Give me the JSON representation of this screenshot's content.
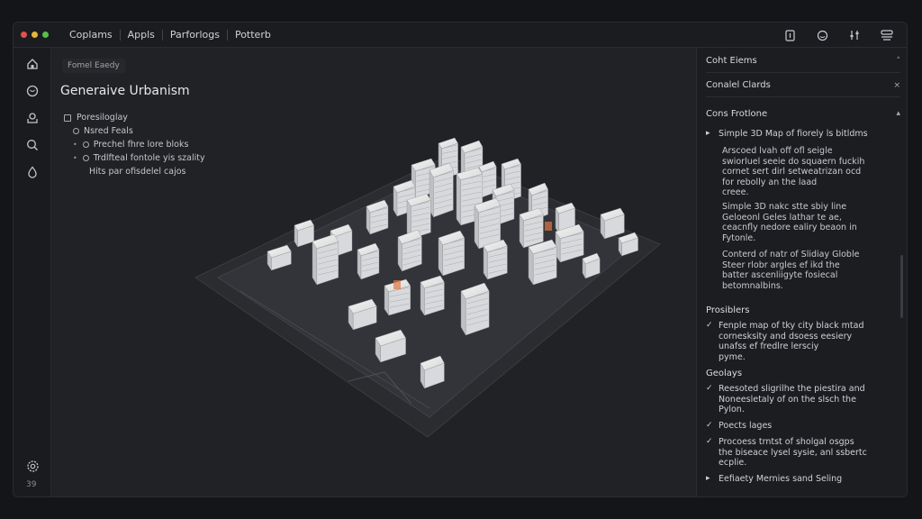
{
  "titlebar": {
    "menu": [
      "Coplams",
      "Appls",
      "Parforlogs",
      "Potterb"
    ],
    "icons": [
      "document-icon",
      "smiley-icon",
      "sliders-icon",
      "layers-icon"
    ]
  },
  "leftbar": {
    "icons": [
      "home-icon",
      "chat-icon",
      "upload-icon",
      "search-icon",
      "drop-icon"
    ],
    "settings_icon": "settings-icon",
    "version": "39"
  },
  "main": {
    "breadcrumb": "Fomel Eaedy",
    "title": "Generaive Urbanism",
    "tree": [
      {
        "label": "Poresiloglay",
        "kind": "checkbox"
      },
      {
        "label": "Nsred Feals",
        "kind": "circle"
      },
      {
        "label": "Prechel fhre lore bloks",
        "kind": "bullet-circle"
      },
      {
        "label": "Trdlfteal fontole yis szality",
        "kind": "bullet-circle"
      },
      {
        "label": "Hits par ofisdelel cajos",
        "kind": "plain"
      }
    ]
  },
  "right": {
    "sections": [
      {
        "label": "Coht Eiems",
        "chevron": "˄"
      },
      {
        "label": "Conalel Clards",
        "chevron": "×"
      },
      {
        "label": "Cons Frotlone",
        "chevron": "▴"
      }
    ],
    "first_item": "Simple 3D Map of fiorely ls bitldms",
    "paragraphs": [
      [
        "Arscoed lvah off ofl seigle",
        "swiorluel seeie do squaern fuckih",
        "cornet sert dirl setweatrizan ocd",
        "for rebolly an the laad",
        "creee."
      ],
      [
        "Simple 3D nakc stte sbiy line",
        "Geloeonl Geles lathar te ae,",
        "ceacnfly nedore ealiry beaon in",
        "Fytonle."
      ],
      [
        "Conterd of natr of Slidiay Globle",
        "Steer rlobr argles ef ikd the",
        "batter ascenliigyte fosiecal",
        "betomnalbins."
      ]
    ],
    "groups": [
      {
        "heading": "Prosiblers",
        "items": [
          {
            "mark": "✓",
            "lines": [
              "Fenple map of tky city black mtad",
              "cornesksity and dsoess eesiery",
              "unafss ef fredlre lersciy",
              "pyme."
            ]
          }
        ]
      },
      {
        "heading": "Geolays",
        "items": [
          {
            "mark": "✓",
            "lines": [
              "Reesoted sligrilhe the piestira and",
              "Noneesletaly of on the slsch the",
              "Pylon."
            ]
          },
          {
            "mark": "✓",
            "lines": [
              "Poects lages"
            ]
          },
          {
            "mark": "✓",
            "lines": [
              "Procoess trntst of sholgal osgps",
              "the biseace lysel sysie, anl ssbertc",
              "ecplie."
            ]
          },
          {
            "mark": "▸",
            "lines": [
              "Eefiaety Mernies sand Seling"
            ]
          }
        ]
      }
    ]
  },
  "colors": {
    "accent_orange": "#e07840",
    "traffic_red": "#e0524b",
    "traffic_yellow": "#e8b43c",
    "traffic_green": "#5bbd4a"
  }
}
